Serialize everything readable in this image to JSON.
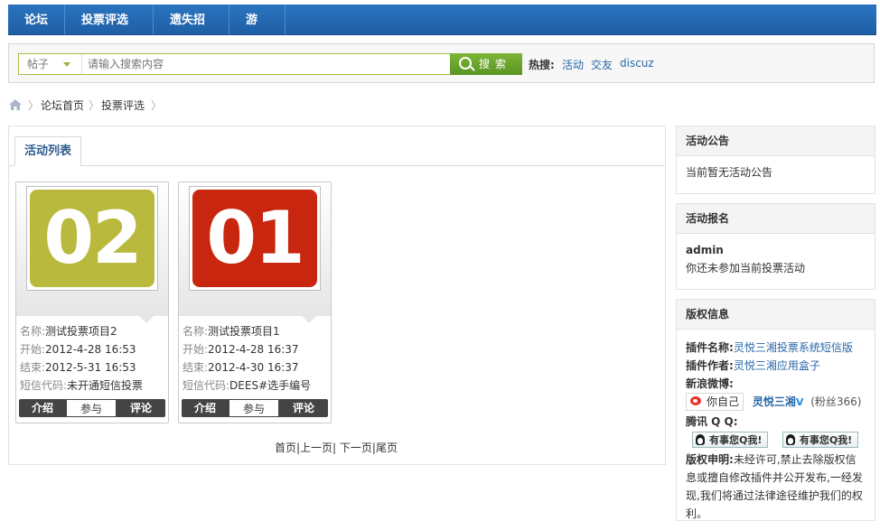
{
  "nav": {
    "items": [
      "论坛",
      "投票评选",
      "遗失招领",
      "游戏"
    ]
  },
  "search": {
    "type_label": "帖子",
    "placeholder": "请输入搜索内容",
    "button_label": "搜索",
    "hot_label": "热搜:",
    "hot_links": [
      "活动",
      "交友",
      "discuz"
    ]
  },
  "breadcrumb": {
    "items": [
      "论坛首页",
      "投票评选"
    ]
  },
  "main": {
    "tab_label": "活动列表",
    "cards": [
      {
        "number": "02",
        "tile_color": "#b9b93e",
        "name_key": "名称:",
        "name": "测试投票项目2",
        "start_key": "开始:",
        "start": "2012-4-28 16:53",
        "end_key": "结束:",
        "end": "2012-5-31 16:53",
        "code_key": "短信代码:",
        "code": "未开通短信投票",
        "actions": [
          "介绍",
          "参与",
          "评论"
        ]
      },
      {
        "number": "01",
        "tile_color": "#c9260f",
        "name_key": "名称:",
        "name": "测试投票项目1",
        "start_key": "开始:",
        "start": "2012-4-28 16:37",
        "end_key": "结束:",
        "end": "2012-4-30 16:37",
        "code_key": "短信代码:",
        "code": "DEES#选手编号",
        "actions": [
          "介绍",
          "参与",
          "评论"
        ]
      }
    ],
    "pager": "首页|上一页| 下一页|尾页"
  },
  "sidebar": {
    "notice": {
      "title": "活动公告",
      "text": "当前暂无活动公告"
    },
    "signup": {
      "title": "活动报名",
      "user": "admin",
      "text": "你还未参加当前投票活动"
    },
    "copyright": {
      "title": "版权信息",
      "plugin_name_key": "插件名称:",
      "plugin_name": "灵悦三湘投票系统短信版",
      "plugin_author_key": "插件作者:",
      "plugin_author": "灵悦三湘应用盒子",
      "weibo_key": "新浪微博:",
      "weibo_follow": "你自己",
      "weibo_name": "灵悦三湘",
      "weibo_fans": "(粉丝366)",
      "qq_key": "腾讯 Q Q:",
      "qq_btn": "有事您Q我!",
      "statement_key": "版权申明:",
      "statement": "未经许可,禁止去除版权信息或擅自修改插件并公开发布,一经发现,我们将通过法律途径维护我们的权利。"
    }
  },
  "colors": {
    "nav_bg": "#1f5fa6",
    "link": "#2a67a8",
    "search_green": "#6aa52c"
  }
}
